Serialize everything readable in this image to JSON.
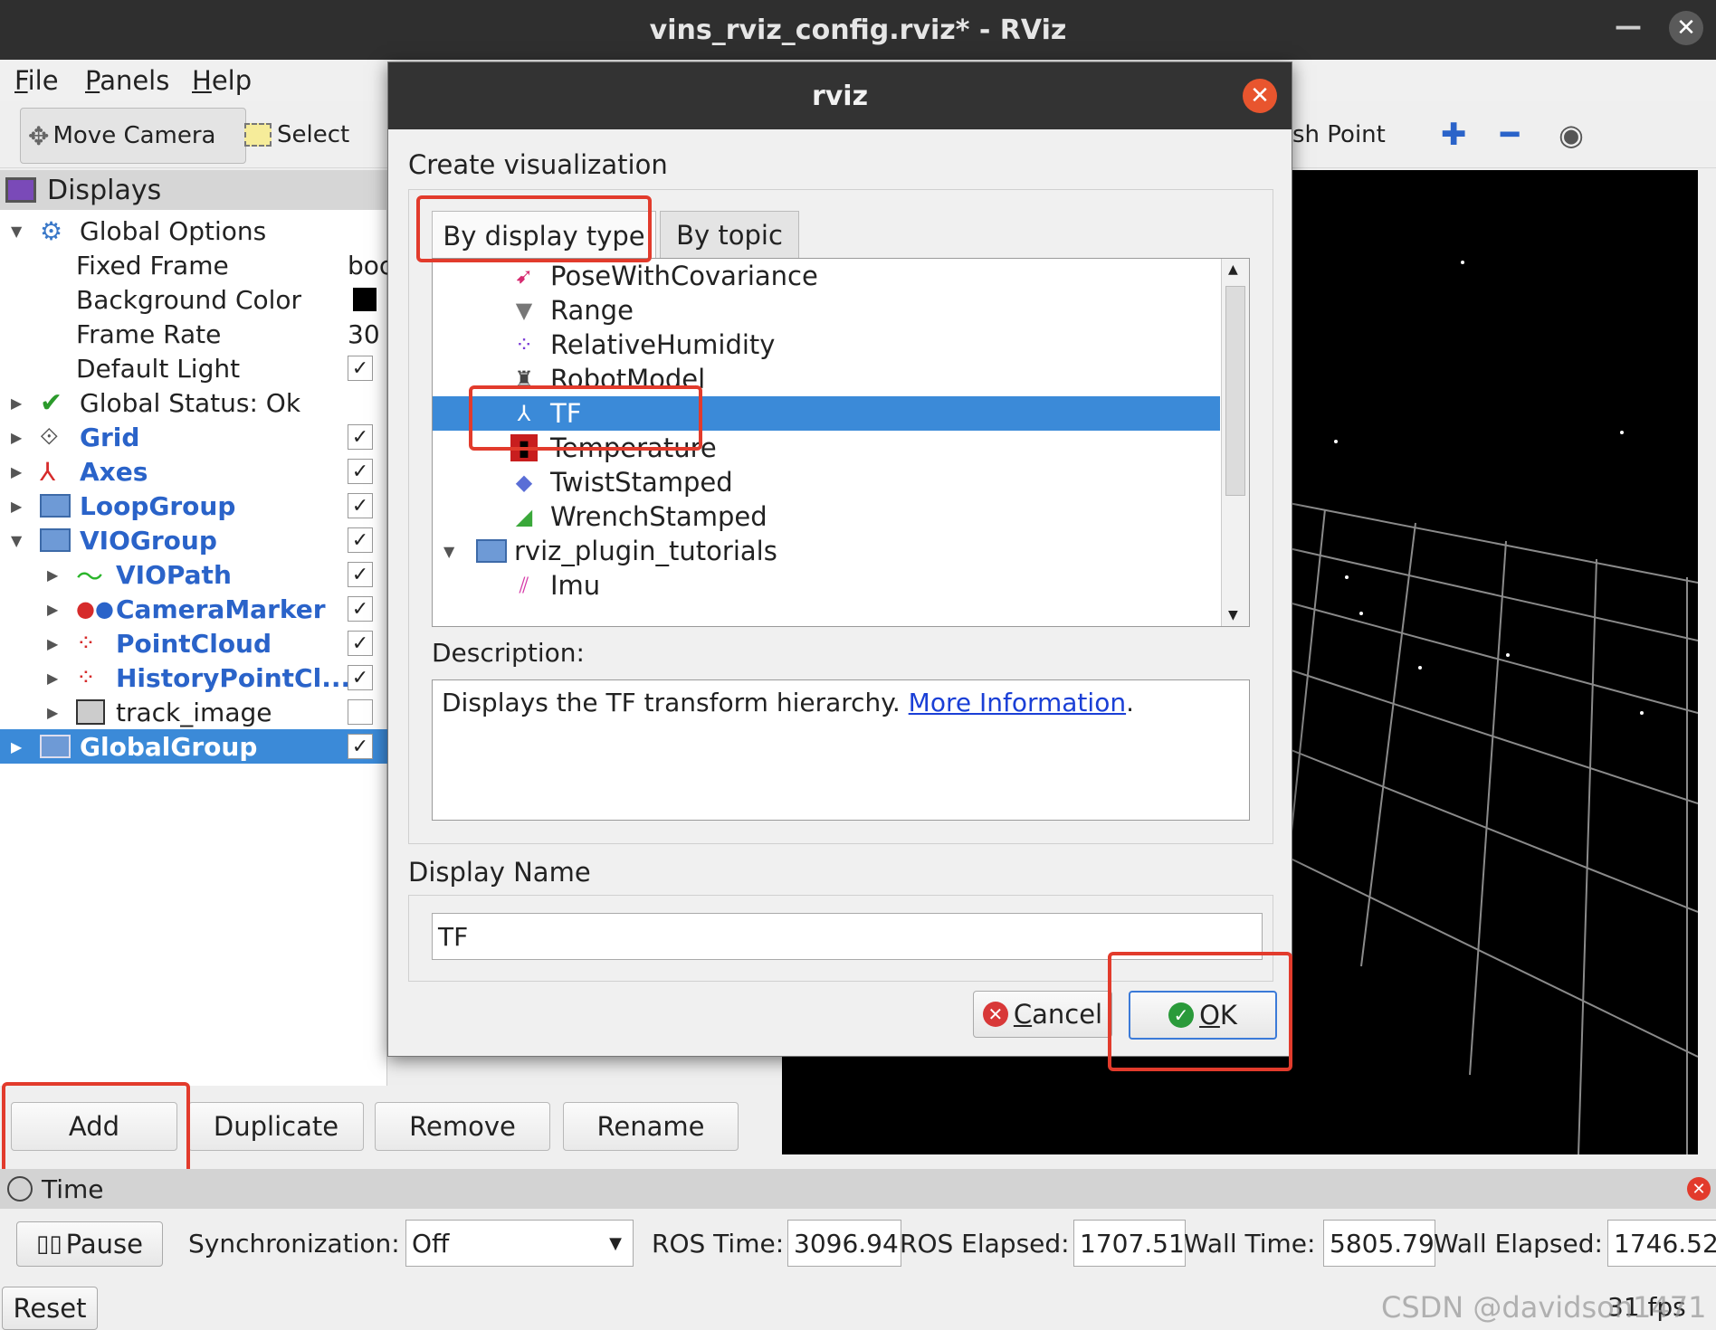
{
  "window": {
    "title": "vins_rviz_config.rviz* - RViz",
    "minimize_glyph": "—",
    "close_glyph": "✕"
  },
  "menu": [
    {
      "label": "File",
      "mnemonic": "F",
      "rest": "ile"
    },
    {
      "label": "Panels",
      "mnemonic": "P",
      "rest": "anels"
    },
    {
      "label": "Help",
      "mnemonic": "H",
      "rest": "elp"
    }
  ],
  "toolbar": {
    "move_camera": "Move Camera",
    "select": "Select",
    "publish_point_partial": "sh Point"
  },
  "displays_panel": {
    "title": "Displays",
    "global_options": "Global Options",
    "fixed_frame_label": "Fixed Frame",
    "fixed_frame_value": "boc",
    "background_color_label": "Background Color",
    "frame_rate_label": "Frame Rate",
    "frame_rate_value": "30",
    "default_light_label": "Default Light",
    "global_status": "Global Status: Ok",
    "items": [
      "Grid",
      "Axes",
      "LoopGroup",
      "VIOGroup",
      "VIOPath",
      "CameraMarker",
      "PointCloud",
      "HistoryPointCl...",
      "track_image",
      "GlobalGroup"
    ],
    "buttons": {
      "add": "Add",
      "duplicate": "Duplicate",
      "remove": "Remove",
      "rename": "Rename"
    }
  },
  "dialog": {
    "title": "rviz",
    "create_label": "Create visualization",
    "tabs": {
      "by_display_type": "By display type",
      "by_topic": "By topic"
    },
    "list": [
      "PoseWithCovariance",
      "Range",
      "RelativeHumidity",
      "RobotModel",
      "TF",
      "Temperature",
      "TwistStamped",
      "WrenchStamped",
      "rviz_plugin_tutorials",
      "Imu"
    ],
    "selected": "TF",
    "description_label": "Description:",
    "description_text": "Displays the TF transform hierarchy. ",
    "description_link": "More Information",
    "description_end": ".",
    "display_name_label": "Display Name",
    "display_name_value": "TF",
    "cancel_mnemonic": "C",
    "cancel_rest": "ancel",
    "ok_mnemonic": "O",
    "ok_rest": "K"
  },
  "time_panel": {
    "title": "Time",
    "pause": "Pause",
    "sync_label": "Synchronization:",
    "sync_value": "Off",
    "ros_time_label": "ROS Time:",
    "ros_time_value": "3096.94",
    "ros_elapsed_label": "ROS Elapsed:",
    "ros_elapsed_value": "1707.51",
    "wall_time_label": "Wall Time:",
    "wall_time_value": "5805.79",
    "wall_elapsed_label": "Wall Elapsed:",
    "wall_elapsed_value": "1746.52",
    "reset": "Reset",
    "fps": "31 fps"
  },
  "watermark": "CSDN @davidson1471",
  "colors": {
    "selection": "#3b8ad8",
    "highlight_box": "#e23b2c",
    "link": "#1a3fd6"
  }
}
